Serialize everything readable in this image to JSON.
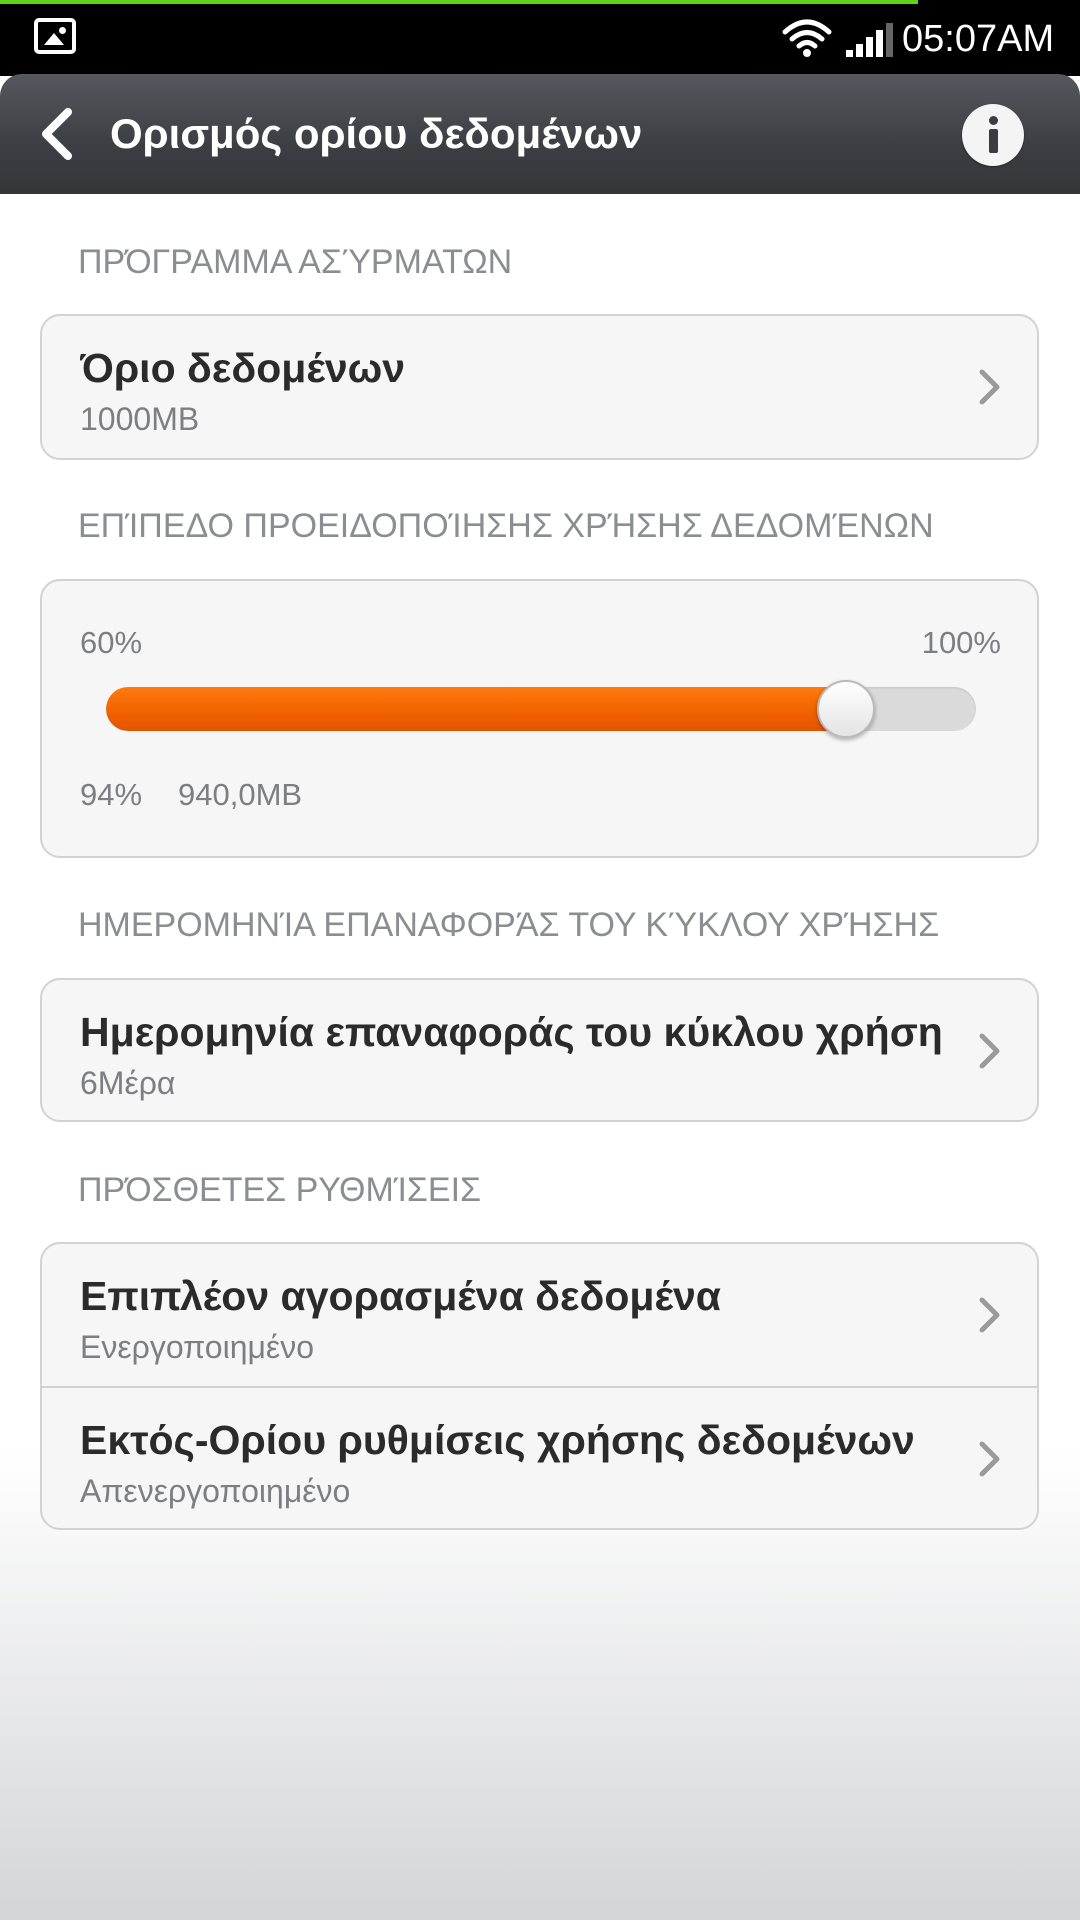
{
  "status_bar": {
    "time": "05:07AM",
    "download_progress": 0.85
  },
  "action_bar": {
    "title": "Ορισμός ορίου δεδομένων"
  },
  "sections": {
    "plan": {
      "header": "ΠΡΌΓΡΑΜΜΑ ΑΣΎΡΜΑΤΩΝ",
      "item": {
        "title": "Όριο δεδομένων",
        "subtitle": "1000MB"
      }
    },
    "warning": {
      "header": "ΕΠΊΠΕΔΟ ΠΡΟΕΙΔΟΠΟΊΗΣΗΣ ΧΡΉΣΗΣ ΔΕΔΟΜΈΝΩΝ",
      "min_label": "60%",
      "max_label": "100%",
      "value_percent": 94,
      "value_label": "94%",
      "value_mb": "940,0MB",
      "accent_color": "#f06000"
    },
    "reset": {
      "header": "ΗΜΕΡΟΜΗΝΊΑ ΕΠΑΝΑΦΟΡΆΣ ΤΟΥ ΚΎΚΛΟΥ ΧΡΉΣΗΣ",
      "item": {
        "title": "Ημερομηνία επαναφοράς του κύκλου χρήση",
        "subtitle": "6Μέρα"
      }
    },
    "extra": {
      "header": "ΠΡΌΣΘΕΤΕΣ ΡΥΘΜΊΣΕΙΣ",
      "items": [
        {
          "title": "Επιπλέον αγορασμένα δεδομένα",
          "subtitle": "Ενεργοποιημένο"
        },
        {
          "title": "Εκτός-Ορίου ρυθμίσεις χρήσης δεδομένων",
          "subtitle": "Απενεργοποιημένο"
        }
      ]
    }
  }
}
